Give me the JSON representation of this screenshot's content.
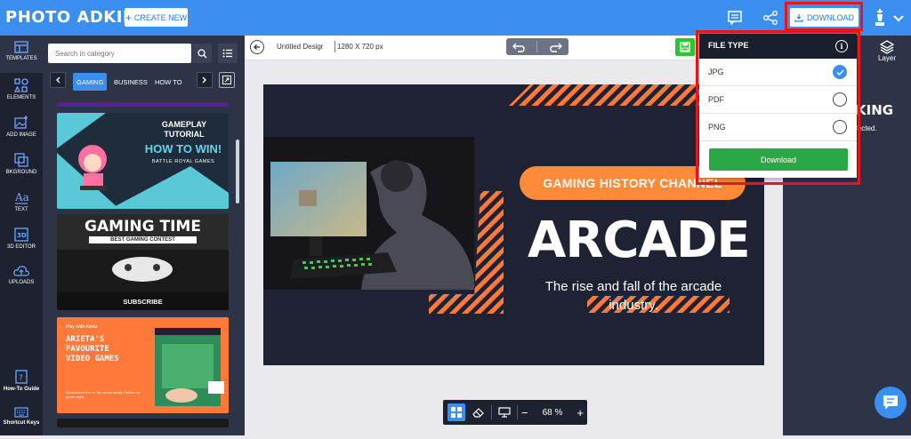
{
  "app": {
    "logo": "PHOTO ADKING",
    "create_new": "CREATE NEW",
    "download": "DOWNLOAD"
  },
  "sidebar": {
    "items": [
      {
        "label": "TEMPLATES",
        "icon": "templates-icon"
      },
      {
        "label": "ELEMENTS",
        "icon": "elements-icon"
      },
      {
        "label": "ADD IMAGE",
        "icon": "add-image-icon"
      },
      {
        "label": "BKGROUND",
        "icon": "background-icon"
      },
      {
        "label": "TEXT",
        "icon": "text-icon"
      },
      {
        "label": "3D EDITOR",
        "icon": "3d-editor-icon"
      },
      {
        "label": "UPLOADS",
        "icon": "uploads-icon"
      }
    ],
    "howto": "How-To Guide",
    "shortcuts": "Shortcut Keys"
  },
  "panel": {
    "search_placeholder": "Search in category",
    "categories": [
      "GAMING",
      "BUSINESS",
      "HOW TO"
    ],
    "cards": [
      {
        "title1": "GAMEPLAY",
        "title2": "TUTORIAL",
        "title3": "HOW TO WIN!",
        "sub": "BATTLE ROYAL GAMES"
      },
      {
        "title1": "GAMING TIME",
        "sub": "BEST GAMING CONTEST",
        "footer": "SUBSCRIBE"
      },
      {
        "kicker": "Play With Arieta",
        "title1": "ARIETA'S",
        "title2": "FAVOURITE",
        "title3": "VIDEO GAMES",
        "sub": "Guaranteed fun for the whole family. Perfect for game night."
      }
    ]
  },
  "editor": {
    "doc_title": "Untitled Desigr",
    "doc_size": "1280 X 720 px",
    "zoom": "68 %"
  },
  "design": {
    "pill": "GAMING HISTORY CHANNEL",
    "headline": "ARCADE",
    "subtitle": "The rise and fall of the arcade industry."
  },
  "right_panel": {
    "layer": "Layer",
    "partial_logo": "KING",
    "partial_text": "lected."
  },
  "download_menu": {
    "header": "FILE TYPE",
    "options": [
      {
        "label": "JPG",
        "selected": true
      },
      {
        "label": "PDF",
        "selected": false
      },
      {
        "label": "PNG",
        "selected": false
      }
    ],
    "button": "Download"
  },
  "colors": {
    "topbar": "#3a8ff0",
    "sidebar": "#1e2230",
    "panel": "#2e3448",
    "accent_orange": "#ff8a3a",
    "download_green": "#2aa845",
    "highlight_red": "#e8161b"
  }
}
